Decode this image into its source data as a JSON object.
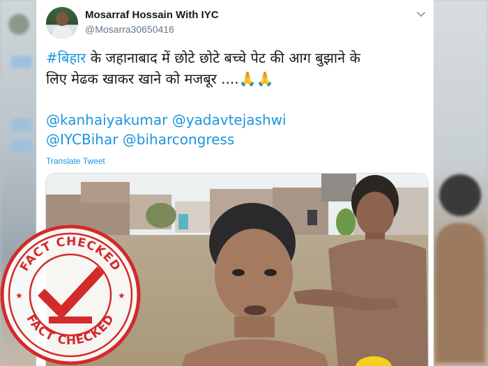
{
  "tweet": {
    "display_name": "Mosarraf Hossain With IYC",
    "handle": "@Mosarra30650416",
    "text_line1_hashtag": "#बिहार",
    "text_line1_rest": " के जहानाबाद में छोटे छोटे बच्चे पेट की आग बुझाने के",
    "text_line2": "लिए मेढक खाकर खाने को मजबूर ....",
    "text_line2_emoji": "🙏🙏",
    "mentions_line1": "@kanhaiyakumar @yadavtejashwi",
    "mentions_line2": "@IYCBihar @biharcongress",
    "translate_label": "Translate Tweet"
  },
  "stamp": {
    "top_text": "FACT CHECKED",
    "bottom_text": "FACT CHECKED",
    "color": "#d32a2a"
  },
  "colors": {
    "link": "#1b95e0",
    "name": "#14171a",
    "muted": "#657786"
  },
  "icons": {
    "menu": "chevron-down-icon",
    "stamp_mark": "checkmark-icon"
  }
}
